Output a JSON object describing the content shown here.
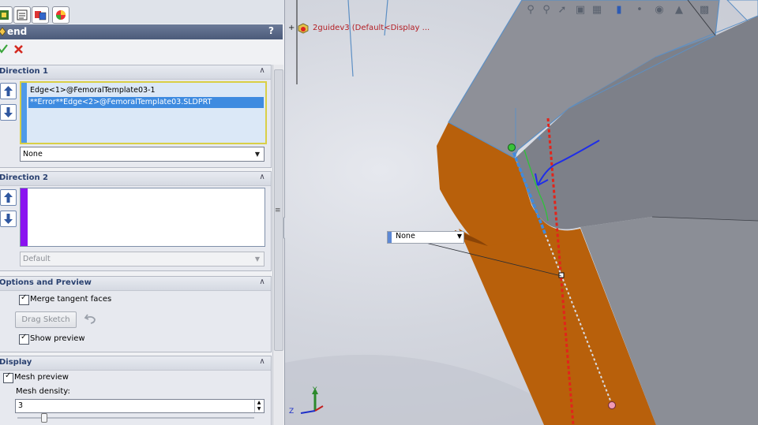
{
  "feature": {
    "title": "end",
    "help": "?"
  },
  "direction1": {
    "header": "Direction 1",
    "items": [
      "Edge<1>@FemoralTemplate03-1",
      "**Error**Edge<2>@FemoralTemplate03.SLDPRT"
    ],
    "condition": "None"
  },
  "direction2": {
    "header": "Direction 2",
    "condition": "Default"
  },
  "options": {
    "header": "Options and Preview",
    "merge_tangent": "Merge tangent faces",
    "drag_sketch": "Drag Sketch",
    "show_preview": "Show preview"
  },
  "display": {
    "header": "Display",
    "mesh_preview": "Mesh preview",
    "mesh_density_label": "Mesh density:",
    "mesh_density_value": "3"
  },
  "viewport": {
    "tree_label": "2guidev3  (Default<Display ...",
    "callout_value": "None",
    "axis_y": "Y",
    "axis_z": "Z"
  },
  "colors": {
    "accent_orange": "#b8600b",
    "selection_blue": "#3e8be0",
    "direction2_purple": "#8a13f0",
    "error_red": "#e1251b",
    "highlight_yellow": "#e3d53a"
  }
}
